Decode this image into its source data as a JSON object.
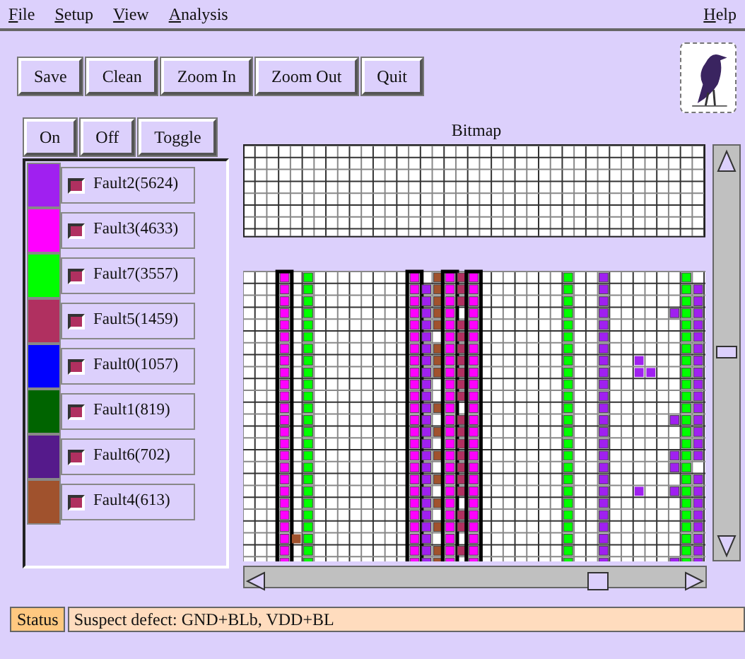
{
  "menu": [
    {
      "label": "File"
    },
    {
      "label": "Setup"
    },
    {
      "label": "View"
    },
    {
      "label": "Analysis"
    }
  ],
  "help_menu": {
    "label": "Help"
  },
  "toolbar": [
    "Save",
    "Clean",
    "Zoom In",
    "Zoom Out",
    "Quit"
  ],
  "fault_buttons": [
    "On",
    "Off",
    "Toggle"
  ],
  "faults": [
    {
      "label": "Fault2(5624)",
      "color": "#a020f0",
      "on": true
    },
    {
      "label": "Fault3(4633)",
      "color": "#ff00ff",
      "on": true
    },
    {
      "label": "Fault7(3557)",
      "color": "#00ff00",
      "on": true
    },
    {
      "label": "Fault5(1459)",
      "color": "#b03060",
      "on": true
    },
    {
      "label": "Fault0(1057)",
      "color": "#0000ff",
      "on": true
    },
    {
      "label": "Fault1(819)",
      "color": "#006400",
      "on": true
    },
    {
      "label": "Fault6(702)",
      "color": "#551a8b",
      "on": true
    },
    {
      "label": "Fault4(613)",
      "color": "#a0522d",
      "on": true
    }
  ],
  "bitmap": {
    "title": "Bitmap"
  },
  "status_bar": {
    "label": "Status",
    "text": "Suspect defect: GND+BLb, VDD+BL"
  }
}
